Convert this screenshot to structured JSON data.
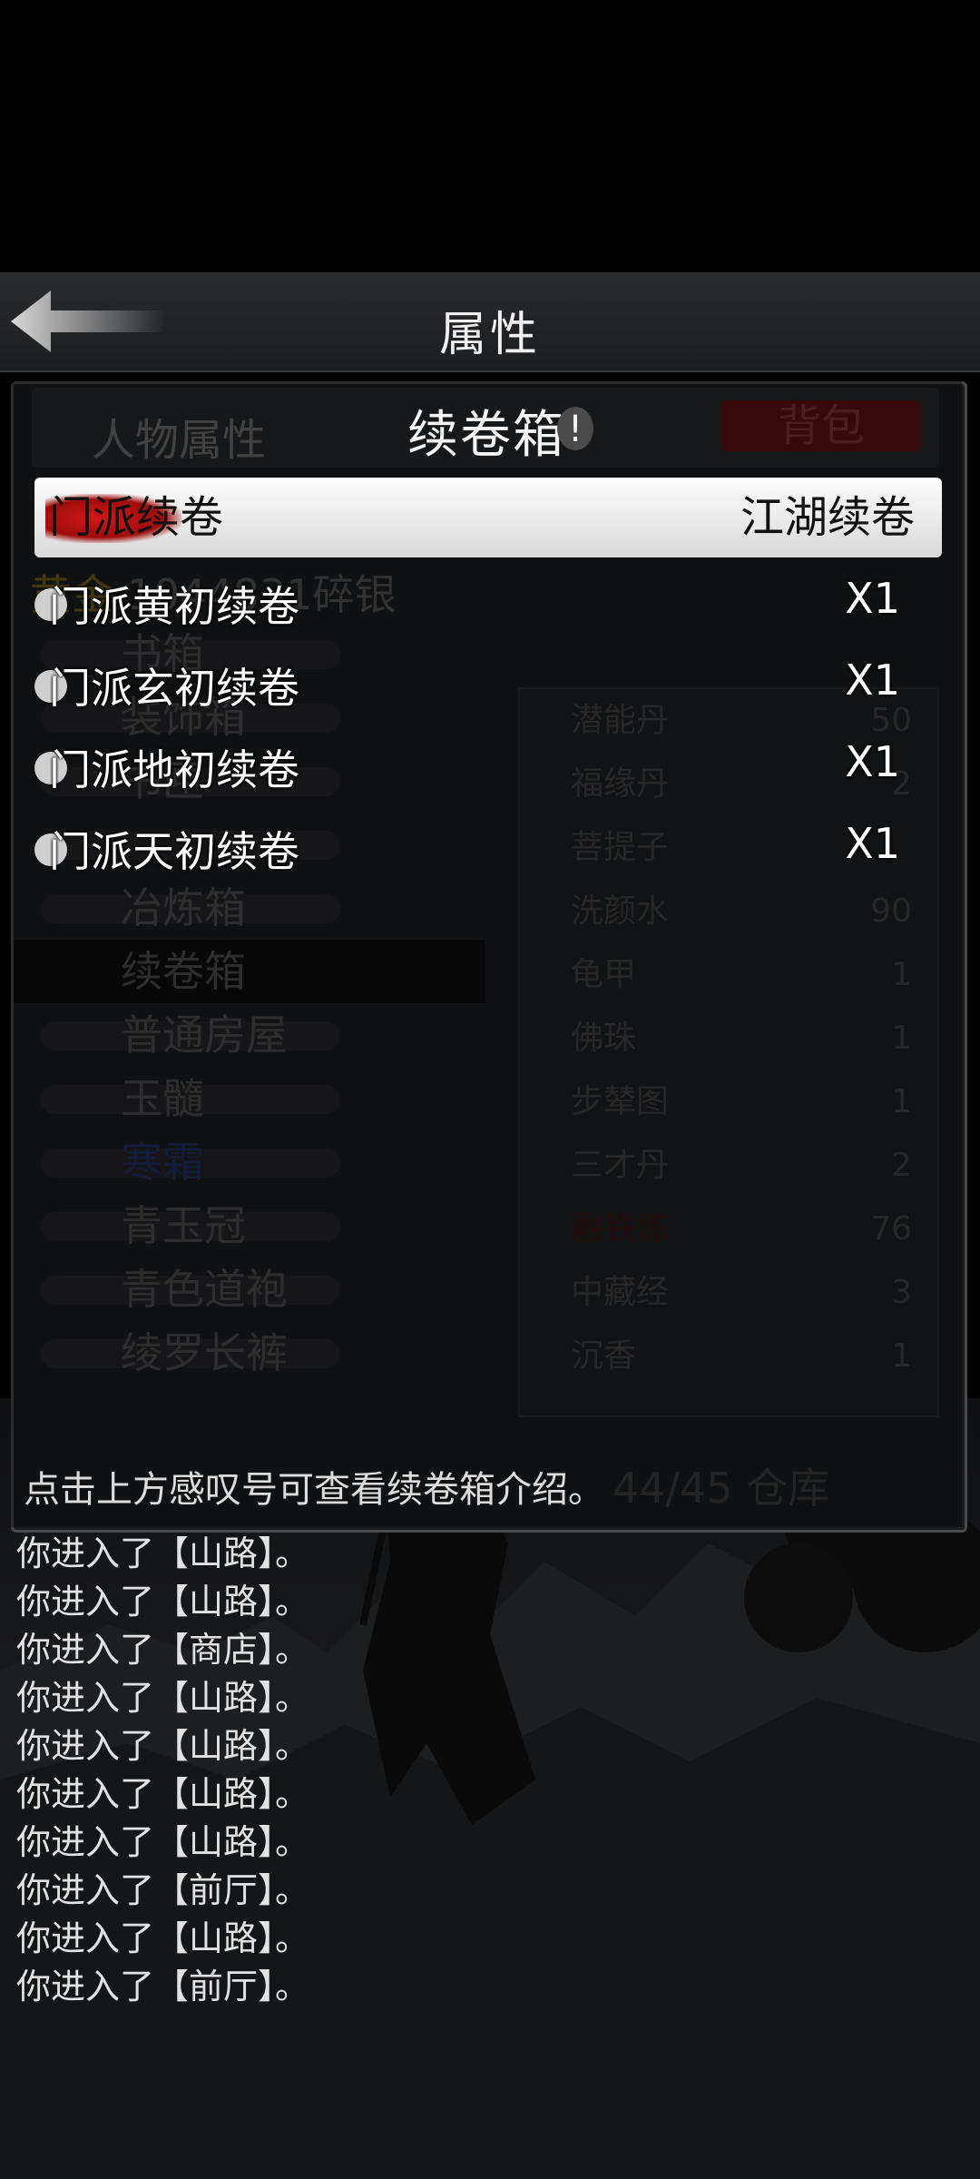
{
  "header": {
    "title": "属性"
  },
  "background_page": {
    "tabs": [
      "人物属性",
      "背包"
    ],
    "money": {
      "gold_label": "黄金",
      "silver": "1044831碎银"
    },
    "categories": [
      "书箱",
      "装饰箱",
      "书匣",
      "",
      "冶炼箱",
      "续卷箱",
      "普通房屋",
      "玉髓",
      "寒霜",
      "青玉冠",
      "青色道袍",
      "绫罗长裤"
    ],
    "items": [
      {
        "name": "潜能丹",
        "count": "50"
      },
      {
        "name": "福缘丹",
        "count": "2"
      },
      {
        "name": "菩提子",
        "count": ""
      },
      {
        "name": "洗颜水",
        "count": "90"
      },
      {
        "name": "龟甲",
        "count": "1"
      },
      {
        "name": "佛珠",
        "count": "1"
      },
      {
        "name": "步辇图",
        "count": "1"
      },
      {
        "name": "三才丹",
        "count": "2"
      },
      {
        "name": "融铁炼",
        "count": "76"
      },
      {
        "name": "中藏经",
        "count": "3"
      },
      {
        "name": "沉香",
        "count": "1"
      }
    ],
    "storage": "44/45 仓库"
  },
  "dialog": {
    "title": "续卷箱",
    "info_mark": "!",
    "tabs": {
      "left": "门派续卷",
      "right": "江湖续卷"
    },
    "rows": [
      {
        "name": "门派黄初续卷",
        "qty": "X1"
      },
      {
        "name": "门派玄初续卷",
        "qty": "X1"
      },
      {
        "name": "门派地初续卷",
        "qty": "X1"
      },
      {
        "name": "门派天初续卷",
        "qty": "X1"
      }
    ],
    "hint": "点击上方感叹号可查看续卷箱介绍。"
  },
  "log": [
    "你进入了【山路】。",
    "你进入了【山路】。",
    "你进入了【商店】。",
    "你进入了【山路】。",
    "你进入了【山路】。",
    "你进入了【山路】。",
    "你进入了【山路】。",
    "你进入了【前厅】。",
    "你进入了【山路】。",
    "你进入了【前厅】。"
  ]
}
